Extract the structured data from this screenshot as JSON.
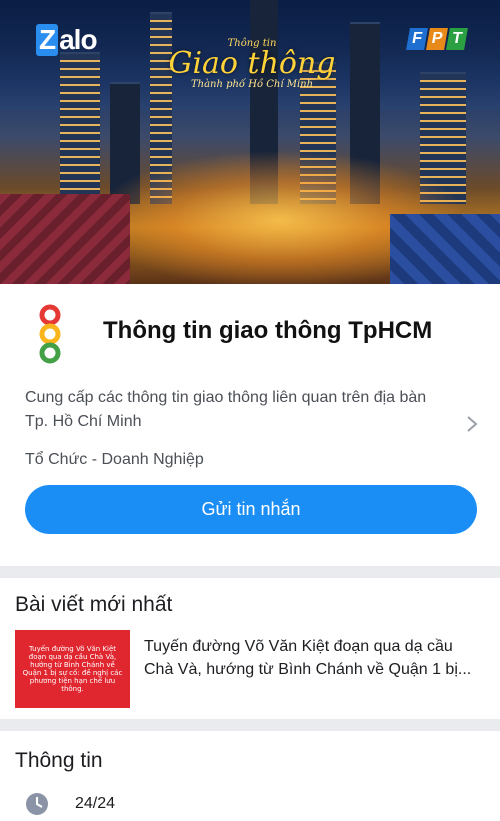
{
  "banner": {
    "zalo_logo": "Zalo",
    "fpt_logo": [
      "F",
      "P",
      "T"
    ],
    "title_small": "Thông tin",
    "title_big": "Giao thông",
    "title_city": "Thành phố Hồ Chí Minh"
  },
  "profile": {
    "name": "Thông tin giao thông TpHCM",
    "description": "Cung cấp các thông tin giao thông liên quan trên địa bàn Tp. Hồ Chí Minh",
    "category": "Tổ Chức - Doanh Nghiệp",
    "send_button": "Gửi tin nhắn",
    "icon": "traffic-light-icon"
  },
  "latest_posts": {
    "title": "Bài viết mới nhất",
    "items": [
      {
        "thumbnail_text": "Tuyến đường Võ Văn Kiệt đoạn qua dạ cầu Chà Và, hướng từ Bình Chánh về Quận 1 bị sự cố: đề nghị các phương tiện hạn chế lưu thông.",
        "title": "Tuyến đường Võ Văn Kiệt đoạn qua dạ cầu Chà Và, hướng từ Bình Chánh về Quận 1 bị..."
      }
    ]
  },
  "info": {
    "title": "Thông tin",
    "hours": "24/24",
    "icon": "clock-icon"
  },
  "colors": {
    "accent": "#1a8ef5",
    "thumbnail": "#e0262f",
    "traffic_red": "#e53935",
    "traffic_yellow": "#f9b51b",
    "traffic_green": "#43a047"
  }
}
